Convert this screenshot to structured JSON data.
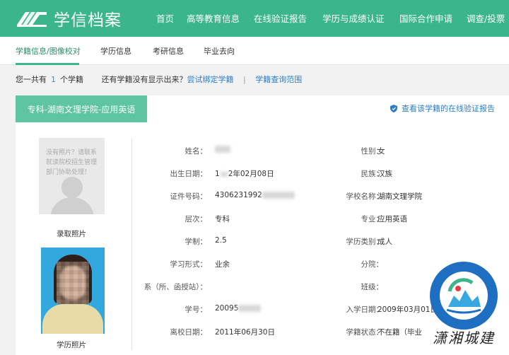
{
  "header": {
    "logo_text": "学信档案",
    "nav": [
      "首页",
      "高等教育信息",
      "在线验证报告",
      "学历与成绩认证",
      "国际合作申请",
      "调查/投票"
    ]
  },
  "subnav": [
    "学籍信息/图像校对",
    "学历信息",
    "考研信息",
    "毕业去向"
  ],
  "info": {
    "prefix": "您一共有",
    "count": "1",
    "suffix": "个学籍",
    "question": "还有学籍没有显示出来？",
    "bind_link": "尝试绑定学籍",
    "sep": "|",
    "range_link": "学籍查询范围"
  },
  "panel": {
    "tab_label": "专科-湖南文理学院-应用英语",
    "verify_label": "查看该学籍的在线验证报告",
    "photo1_note": "没有照片？请联系就读院校招生管理部门协助处理！",
    "photo1_label": "录取照片",
    "photo2_label": "学历照片"
  },
  "fields": {
    "name_label": "姓名：",
    "gender_label": "性别：",
    "gender": "女",
    "birth_label": "出生日期：",
    "birth_prefix": "1",
    "birth_suffix": "2年02月08日",
    "ethnic_label": "民族：",
    "ethnic": "汉族",
    "id_label": "证件号码：",
    "id_prefix": "4306231992",
    "school_label": "学校名称：",
    "school": "湖南文理学院",
    "level_label": "层次：",
    "level": "专科",
    "major_label": "专业：",
    "major": "应用英语",
    "length_label": "学制：",
    "length": "2.5",
    "category_label": "学历类别：",
    "category": "成人",
    "form_label": "学习形式：",
    "form": "业余",
    "branch_label": "分院：",
    "dept_label": "系（所、函授站）：",
    "class_label": "班级：",
    "stuno_label": "学号：",
    "stuno_prefix": "20095",
    "enroll_label": "入学日期：",
    "enroll": "2009年03月01日",
    "leave_label": "离校日期：",
    "leave": "2011年06月30日",
    "status_label": "学籍状态：",
    "status": "不在籍（毕业"
  },
  "watermark": {
    "text": "潇湘城建"
  },
  "colors": {
    "brand": "#3bb58b",
    "tab": "#5fc4a2",
    "link": "#2e7dc4"
  }
}
